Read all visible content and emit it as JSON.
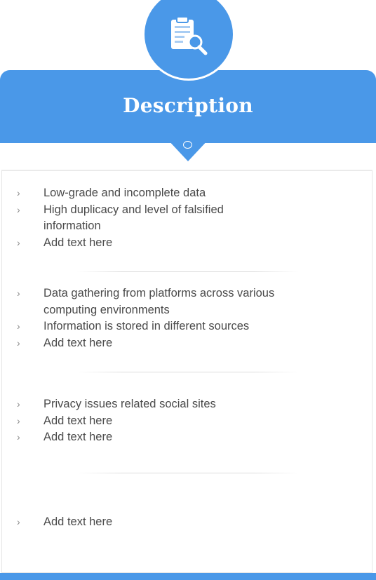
{
  "header": {
    "title": "Description",
    "icon": "clipboard-search-icon",
    "accent_color": "#4a98e8"
  },
  "groups": [
    {
      "items": [
        "Low-grade and incomplete data",
        "High  duplicacy and level of falsified information",
        "Add text here"
      ]
    },
    {
      "items": [
        "Data  gathering from platforms across various computing environments",
        "Information is stored in different sources",
        "Add text here"
      ]
    },
    {
      "items": [
        "Privacy issues related social sites",
        "Add text here",
        "Add text here"
      ]
    },
    {
      "items": [
        "Add text here"
      ]
    }
  ],
  "bullet_glyph": "›"
}
